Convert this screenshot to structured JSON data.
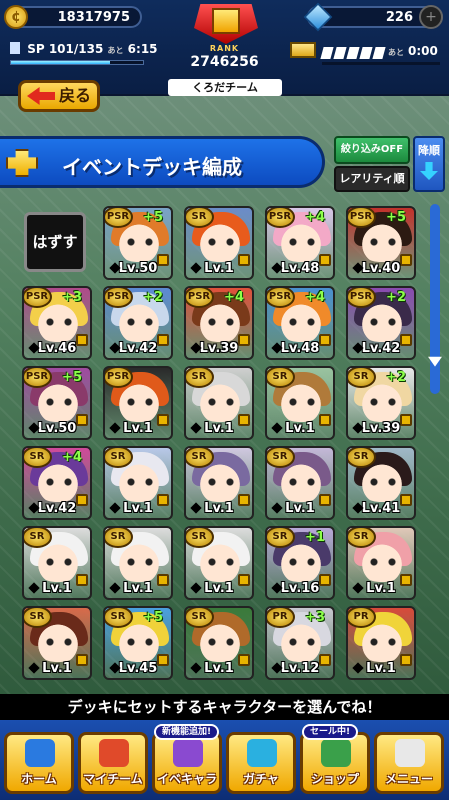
{
  "header": {
    "coins": "18317975",
    "gems": "226",
    "sp_label": "SP",
    "sp_value": "101/135",
    "sp_time_prefix": "あと",
    "sp_time": "6:15",
    "sp_fill_fraction": 0.75,
    "rank_label": "RANK",
    "rank_points": "2746256",
    "team_name": "くろだチーム",
    "seg_time_prefix": "あと",
    "seg_time": "0:00"
  },
  "nav_back": {
    "label": "戻る"
  },
  "title": {
    "text": "イベントデッキ編成"
  },
  "controls": {
    "filter_label": "絞り込みOFF",
    "rarity_label": "レアリティ順",
    "order_label": "降順"
  },
  "grid": {
    "unequip_label": "はずす",
    "cards": [
      {
        "rarity": "PSR",
        "plus": "+5",
        "level": "Lv.50",
        "hair": "#e07b2a",
        "bg": "#7aa3c8"
      },
      {
        "rarity": "SR",
        "plus": "",
        "level": "Lv.1",
        "hair": "#e85b1c",
        "bg": "#6b8cc9"
      },
      {
        "rarity": "PSR",
        "plus": "+4",
        "level": "Lv.48",
        "hair": "#f3a9c7",
        "bg": "#d9c7e8"
      },
      {
        "rarity": "PSR",
        "plus": "+5",
        "level": "Lv.40",
        "hair": "#2c1a12",
        "bg": "#c2312b"
      },
      {
        "rarity": "PSR",
        "plus": "+3",
        "level": "Lv.46",
        "hair": "#f3cf4a",
        "bg": "#b04a8a"
      },
      {
        "rarity": "PSR",
        "plus": "+2",
        "level": "Lv.42",
        "hair": "#c8d8ec",
        "bg": "#5c8ad4"
      },
      {
        "rarity": "PSR",
        "plus": "+4",
        "level": "Lv.39",
        "hair": "#7a3a1a",
        "bg": "#e0503a"
      },
      {
        "rarity": "PSR",
        "plus": "+4",
        "level": "Lv.48",
        "hair": "#f08a2a",
        "bg": "#4a90d0"
      },
      {
        "rarity": "PSR",
        "plus": "+2",
        "level": "Lv.42",
        "hair": "#3a2a4a",
        "bg": "#8a4ab0"
      },
      {
        "rarity": "PSR",
        "plus": "+5",
        "level": "Lv.50",
        "hair": "#8a3a6a",
        "bg": "#a04aa0"
      },
      {
        "rarity": "PSR",
        "plus": "",
        "level": "Lv.1",
        "hair": "#e05a1a",
        "bg": "#2a2a2a"
      },
      {
        "rarity": "SR",
        "plus": "",
        "level": "Lv.1",
        "hair": "#d8d8d8",
        "bg": "#cfcfcf"
      },
      {
        "rarity": "SR",
        "plus": "",
        "level": "Lv.1",
        "hair": "#b07a3a",
        "bg": "#9ac3a0"
      },
      {
        "rarity": "SR",
        "plus": "+2",
        "level": "Lv.39",
        "hair": "#f0d7a2",
        "bg": "#e8e8e8"
      },
      {
        "rarity": "SR",
        "plus": "+4",
        "level": "Lv.42",
        "hair": "#6a3a9a",
        "bg": "#d04a9a"
      },
      {
        "rarity": "SR",
        "plus": "",
        "level": "Lv.1",
        "hair": "#e8e8f0",
        "bg": "#b8c8e8"
      },
      {
        "rarity": "SR",
        "plus": "",
        "level": "Lv.1",
        "hair": "#7a6aa0",
        "bg": "#d0c8e0"
      },
      {
        "rarity": "SR",
        "plus": "",
        "level": "Lv.1",
        "hair": "#7a5a8a",
        "bg": "#c4b8d8"
      },
      {
        "rarity": "SR",
        "plus": "",
        "level": "Lv.41",
        "hair": "#2a1a1a",
        "bg": "#a0b8c8"
      },
      {
        "rarity": "SR",
        "plus": "",
        "level": "Lv.1",
        "hair": "#f2f2f2",
        "bg": "#dcdcdc"
      },
      {
        "rarity": "SR",
        "plus": "",
        "level": "Lv.1",
        "hair": "#f2f2f2",
        "bg": "#dcdcdc"
      },
      {
        "rarity": "SR",
        "plus": "",
        "level": "Lv.1",
        "hair": "#f2f2f2",
        "bg": "#dcdcdc"
      },
      {
        "rarity": "SR",
        "plus": "+1",
        "level": "Lv.16",
        "hair": "#4a3a6a",
        "bg": "#b8a8d8"
      },
      {
        "rarity": "SR",
        "plus": "",
        "level": "Lv.1",
        "hair": "#f0a0a8",
        "bg": "#e0c8b8"
      },
      {
        "rarity": "SR",
        "plus": "",
        "level": "Lv.1",
        "hair": "#6a2a1a",
        "bg": "#d86a4a"
      },
      {
        "rarity": "SR",
        "plus": "+5",
        "level": "Lv.45",
        "hair": "#f0d23a",
        "bg": "#4aa0e0"
      },
      {
        "rarity": "SR",
        "plus": "",
        "level": "Lv.1",
        "hair": "#b06a2a",
        "bg": "#3a7a3a"
      },
      {
        "rarity": "PR",
        "plus": "+3",
        "level": "Lv.12",
        "hair": "#d8d8e0",
        "bg": "#c8c8d0"
      },
      {
        "rarity": "PR",
        "plus": "",
        "level": "Lv.1",
        "hair": "#f0d43a",
        "bg": "#d84a3a"
      }
    ]
  },
  "hint": {
    "text": "デッキにセットするキャラクターを選んでね！"
  },
  "bottom_nav": {
    "items": [
      {
        "label": "ホーム",
        "tag": "",
        "icon_color": "#2a7ae0"
      },
      {
        "label": "マイチーム",
        "tag": "",
        "icon_color": "#e04a2a"
      },
      {
        "label": "イベキャラ",
        "tag": "新機能追加!",
        "icon_color": "#8a4ad0"
      },
      {
        "label": "ガチャ",
        "tag": "",
        "icon_color": "#2ab0e0"
      },
      {
        "label": "ショップ",
        "tag": "セール中!",
        "icon_color": "#3aa04a"
      },
      {
        "label": "メニュー",
        "tag": "",
        "icon_color": "#e8e8e8"
      }
    ]
  }
}
